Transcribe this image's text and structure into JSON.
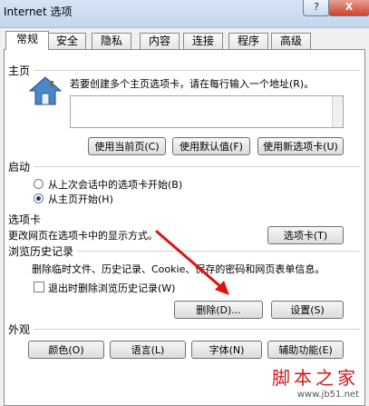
{
  "window": {
    "title": "Internet 选项",
    "help_label": "?",
    "close_label": "X"
  },
  "tabs": [
    "常规",
    "安全",
    "隐私",
    "内容",
    "连接",
    "程序",
    "高级"
  ],
  "home": {
    "title": "主页",
    "desc": "若要创建多个主页选项卡，请在每行输入一个地址(R)。",
    "buttons": [
      "使用当前页(C)",
      "使用默认值(F)",
      "使用新选项卡(U)"
    ]
  },
  "startup": {
    "title": "启动",
    "options": [
      "从上次会话中的选项卡开始(B)",
      "从主页开始(H)"
    ],
    "selected": "从主页开始(H)"
  },
  "tabsect": {
    "title": "选项卡",
    "desc": "更改网页在选项卡中的显示方式。",
    "button": "选项卡(T)"
  },
  "history": {
    "title": "浏览历史记录",
    "desc": "删除临时文件、历史记录、Cookie、保存的密码和网页表单信息。",
    "checkbox": "退出时删除浏览历史记录(W)",
    "delete_button": "删除(D)...",
    "settings_button": "设置(S)"
  },
  "appearance": {
    "title": "外观",
    "buttons": [
      "颜色(O)",
      "语言(L)",
      "字体(N)",
      "辅助功能(E)"
    ]
  },
  "watermark": {
    "brand": "脚本之家",
    "url": "www.jb51.net"
  },
  "colors": {
    "arrow": "#e01010"
  }
}
